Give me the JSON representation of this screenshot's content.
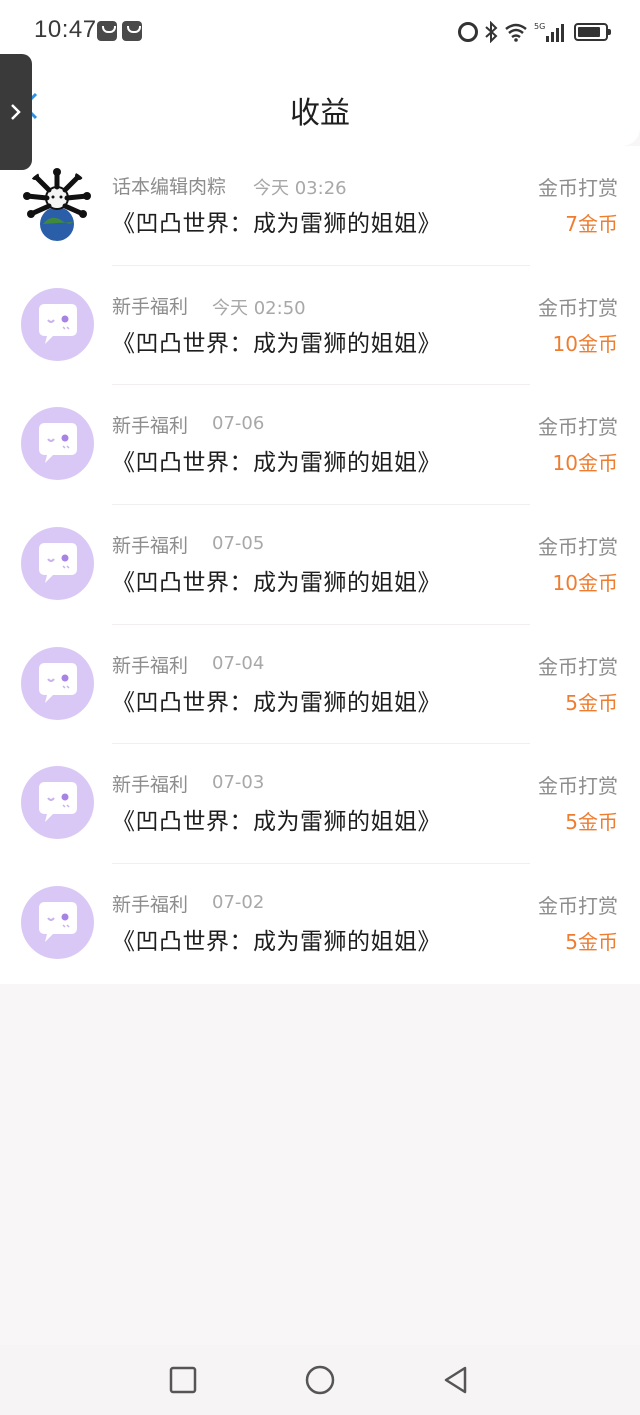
{
  "status_bar": {
    "time": "10:47",
    "icons": [
      "notification-icon",
      "notification-icon",
      "alarm-icon",
      "bluetooth-icon",
      "wifi-icon",
      "signal-5g-icon",
      "battery-icon"
    ]
  },
  "header": {
    "title": "收益",
    "back_icon": "chevron-left-icon"
  },
  "side_handle": {
    "icon": "chevron-right-icon"
  },
  "rows": [
    {
      "sender": "话本编辑肉粽",
      "time": "今天 03:26",
      "book": "《凹凸世界：成为雷狮的姐姐》",
      "type": "金币打赏",
      "amount": "7金币",
      "avatar": "photo"
    },
    {
      "sender": "新手福利",
      "time": "今天 02:50",
      "book": "《凹凸世界：成为雷狮的姐姐》",
      "type": "金币打赏",
      "amount": "10金币",
      "avatar": "bubble"
    },
    {
      "sender": "新手福利",
      "time": "07-06",
      "book": "《凹凸世界：成为雷狮的姐姐》",
      "type": "金币打赏",
      "amount": "10金币",
      "avatar": "bubble"
    },
    {
      "sender": "新手福利",
      "time": "07-05",
      "book": "《凹凸世界：成为雷狮的姐姐》",
      "type": "金币打赏",
      "amount": "10金币",
      "avatar": "bubble"
    },
    {
      "sender": "新手福利",
      "time": "07-04",
      "book": "《凹凸世界：成为雷狮的姐姐》",
      "type": "金币打赏",
      "amount": "5金币",
      "avatar": "bubble"
    },
    {
      "sender": "新手福利",
      "time": "07-03",
      "book": "《凹凸世界：成为雷狮的姐姐》",
      "type": "金币打赏",
      "amount": "5金币",
      "avatar": "bubble"
    },
    {
      "sender": "新手福利",
      "time": "07-02",
      "book": "《凹凸世界：成为雷狮的姐姐》",
      "type": "金币打赏",
      "amount": "5金币",
      "avatar": "bubble"
    }
  ],
  "colors": {
    "amount": "#ee7d30",
    "avatar_bg": "#d9c8f5",
    "accent": "#2f8fe0"
  },
  "nav_bar": {
    "icons": [
      "recent-apps-icon",
      "home-icon",
      "back-icon"
    ]
  }
}
